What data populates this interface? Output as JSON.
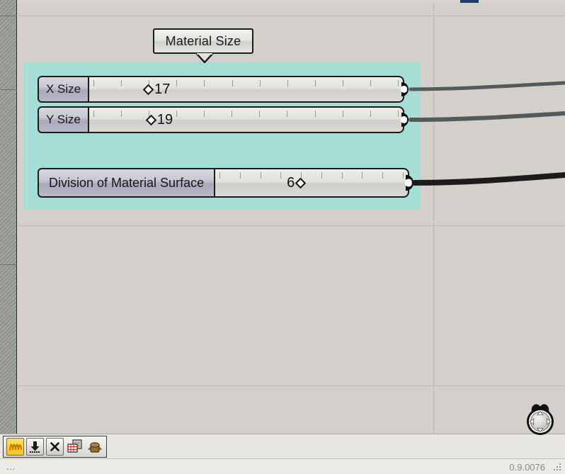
{
  "app": {
    "version_label": "0.9.0076",
    "status_message": "..."
  },
  "canvas": {
    "group_label": "Material Size",
    "background_color": "#d3d0cb",
    "group_color": "#a5ded4",
    "grid_color": "#bdbab4"
  },
  "nodes": [
    {
      "id": "x-size",
      "name": "X Size",
      "value": "17",
      "tick_count": 12,
      "handle_position_pct": 20,
      "port_label": "output"
    },
    {
      "id": "y-size",
      "name": "Y Size",
      "value": "19",
      "tick_count": 12,
      "handle_position_pct": 22,
      "port_label": "output"
    },
    {
      "id": "division-of-material-surface",
      "name": "Division of Material Surface",
      "value": "6",
      "tick_count": 10,
      "handle_position_pct": 48,
      "port_label": "output"
    }
  ],
  "toolbar": {
    "buttons": [
      {
        "name": "bake-squiggle",
        "icon": "squiggle-icon",
        "label": ""
      },
      {
        "name": "download",
        "icon": "download-arrow-icon",
        "label": ""
      },
      {
        "name": "close",
        "icon": "close-x-icon",
        "label": "×"
      },
      {
        "name": "grid-table",
        "icon": "grid-table-icon",
        "label": ""
      },
      {
        "name": "tree-stump",
        "icon": "tree-stump-icon",
        "label": ""
      }
    ]
  },
  "nav_widget": {
    "name": "compass-navigator",
    "label": ""
  }
}
